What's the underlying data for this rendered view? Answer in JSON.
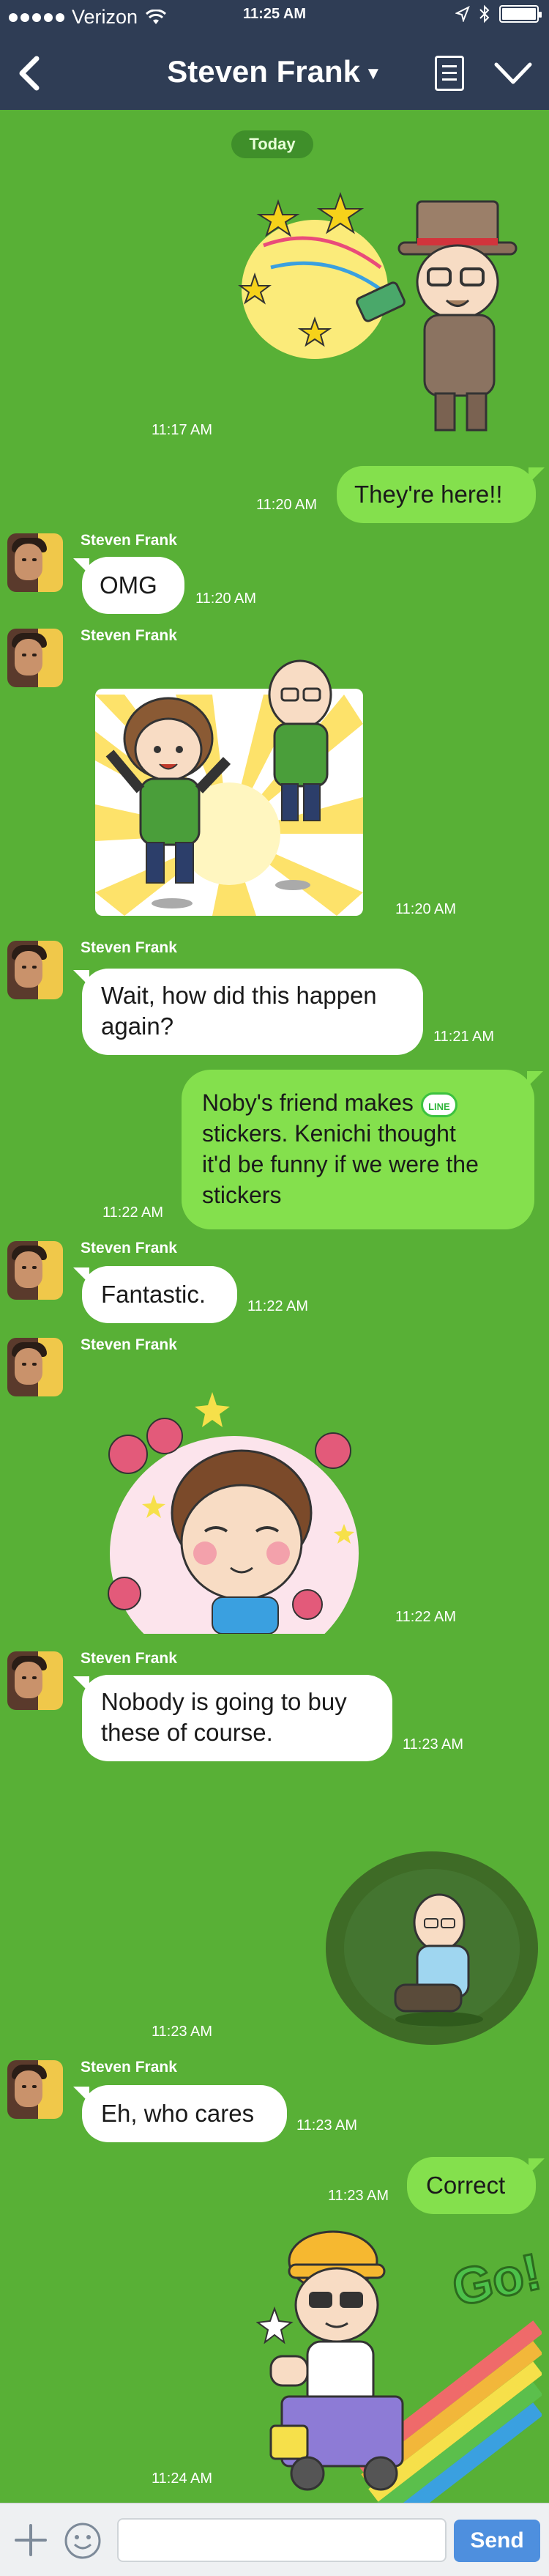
{
  "status_bar": {
    "carrier": "Verizon",
    "time": "11:25 AM"
  },
  "nav": {
    "title": "Steven Frank"
  },
  "chat": {
    "date_label": "Today",
    "messages": [
      {
        "time": "11:17 AM"
      },
      {
        "text": "They're here!!",
        "time": "11:20 AM"
      },
      {
        "sender": "Steven Frank",
        "text": "OMG",
        "time": "11:20 AM"
      },
      {
        "sender": "Steven Frank",
        "time": "11:20 AM"
      },
      {
        "sender": "Steven Frank",
        "text_l1": "Wait, how did this happen",
        "text_l2": "again?",
        "time": "11:21 AM"
      },
      {
        "text_l1": "Noby's friend makes",
        "text_l2": "stickers. Kenichi thought",
        "text_l3": "it'd be funny if we were the",
        "text_l4": "stickers",
        "badge": "LINE",
        "time": "11:22 AM"
      },
      {
        "sender": "Steven Frank",
        "text": "Fantastic.",
        "time": "11:22 AM"
      },
      {
        "sender": "Steven Frank",
        "time": "11:22 AM"
      },
      {
        "sender": "Steven Frank",
        "text_l1": "Nobody is going to buy",
        "text_l2": "these of course.",
        "time": "11:23 AM"
      },
      {
        "time": "11:23 AM"
      },
      {
        "sender": "Steven Frank",
        "text": "Eh, who cares",
        "time": "11:23 AM"
      },
      {
        "text": "Correct",
        "time": "11:23 AM"
      },
      {
        "time": "11:24 AM",
        "sticker_text": "Go!"
      }
    ]
  },
  "input_bar": {
    "placeholder": "",
    "send_label": "Send"
  },
  "colors": {
    "background": "#58b036",
    "nav": "#2f3d55",
    "bubble_out": "#84e04d",
    "bubble_in": "#ffffff",
    "send": "#4e8fde"
  }
}
